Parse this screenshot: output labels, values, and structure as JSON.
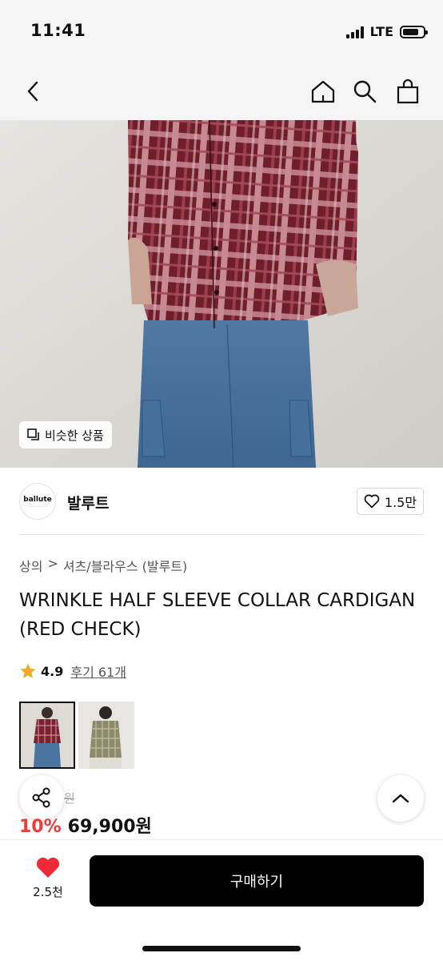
{
  "status": {
    "time": "11:41",
    "network": "LTE"
  },
  "similar_button_label": "비슷한 상품",
  "brand": {
    "logo_text": "ballute",
    "name": "발루트",
    "likes": "1.5만"
  },
  "breadcrumb": {
    "category": "상의",
    "separator": ">",
    "subcategory": "셔츠/블라우스 (발루트)"
  },
  "product": {
    "title": "WRINKLE HALF SLEEVE COLLAR CARDIGAN (RED CHECK)"
  },
  "rating": {
    "score": "4.9",
    "reviews": "후기 61개",
    "star_color": "#f5a623"
  },
  "price": {
    "original": "원",
    "discount": "10%",
    "sale": "69,900원",
    "discount_color": "#f03a3a"
  },
  "bottom": {
    "wish_count": "2.5천",
    "buy_label": "구매하기",
    "heart_color": "#ef2b3a"
  },
  "icons": [
    "back-icon",
    "home-icon",
    "search-icon",
    "bag-icon",
    "copy-icon",
    "heart-outline-icon",
    "star-icon",
    "share-icon",
    "chevron-up-icon",
    "heart-filled-icon"
  ]
}
